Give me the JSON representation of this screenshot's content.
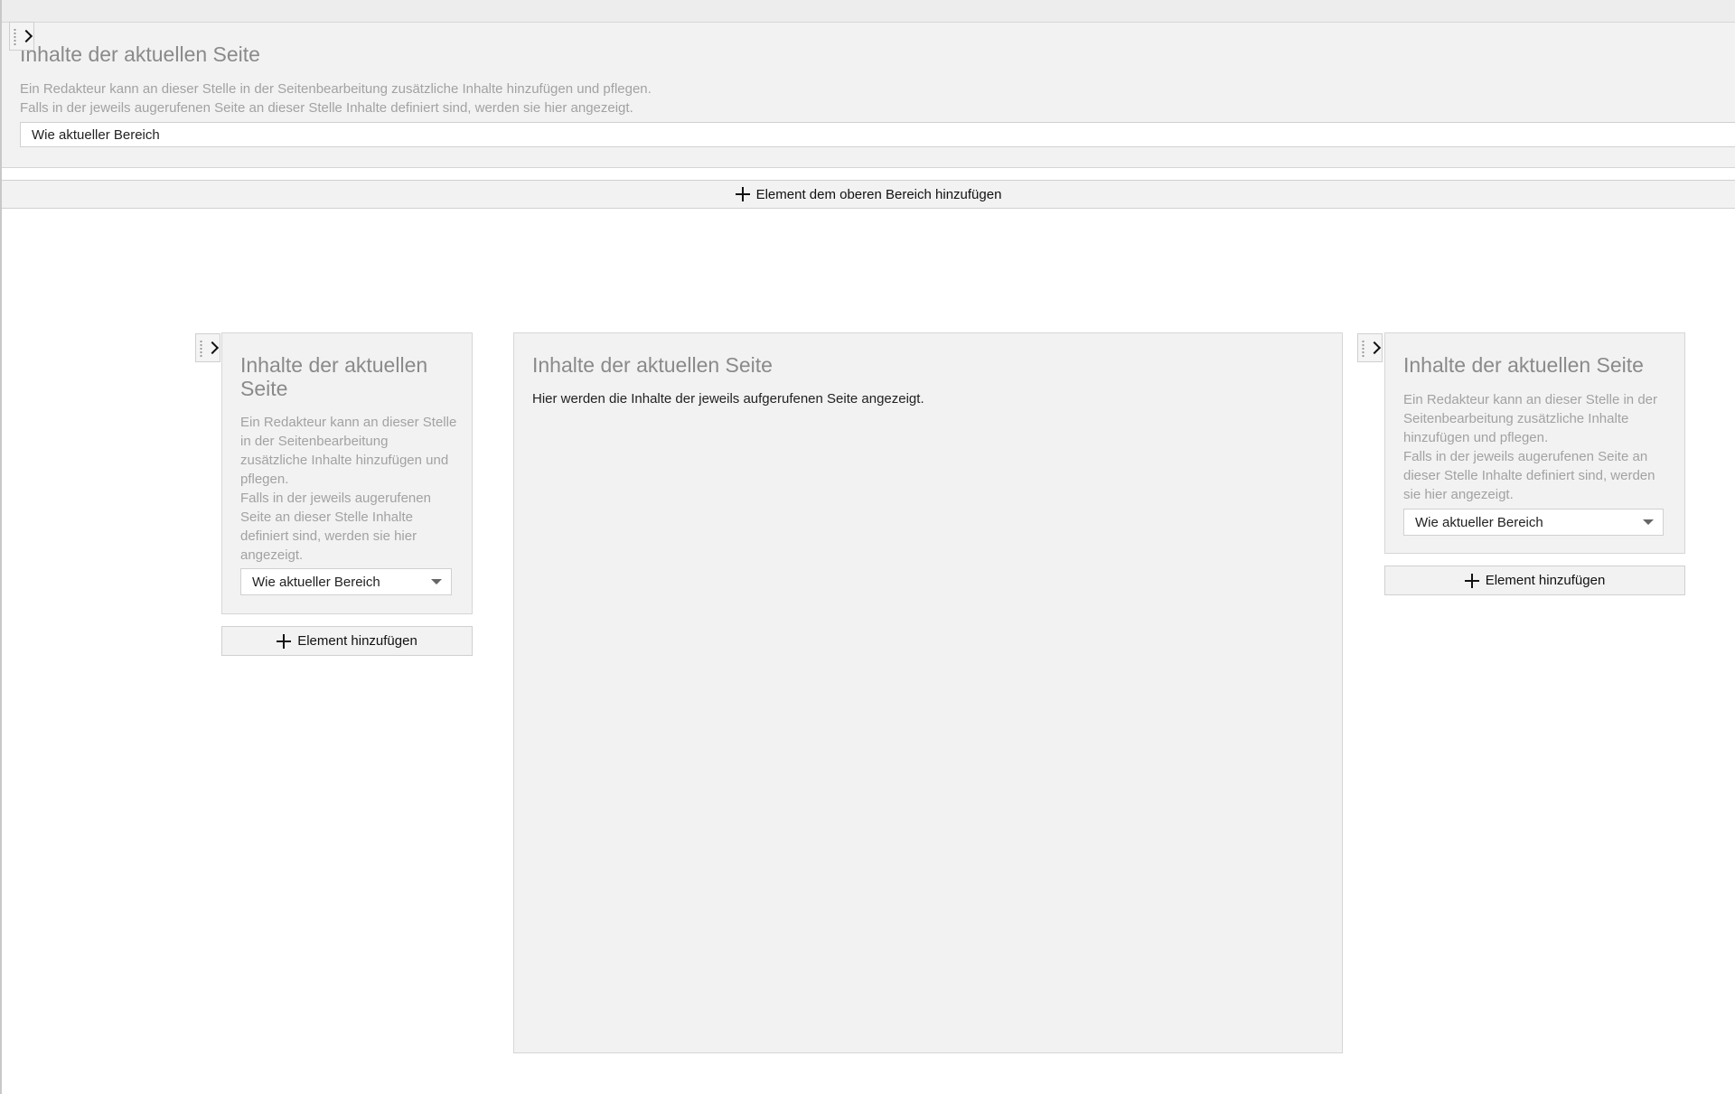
{
  "top_area": {
    "title": "Inhalte der aktuellen Seite",
    "desc_lines": [
      "Ein Redakteur kann an dieser Stelle in der Seitenbearbeitung zusätzliche Inhalte hinzufügen und pflegen.",
      "Falls in der jeweils augerufenen Seite an dieser Stelle Inhalte definiert sind, werden sie hier angezeigt."
    ],
    "select_value": "Wie aktueller Bereich",
    "add_button_label": "Element dem oberen Bereich hinzufügen"
  },
  "left_area": {
    "title": "Inhalte der aktuellen Seite",
    "desc_lines": [
      "Ein Redakteur kann an dieser Stelle in der Seitenbearbeitung zusätzliche Inhalte hinzufügen und pflegen.",
      "Falls in der jeweils augerufenen Seite an dieser Stelle Inhalte definiert sind, werden sie hier angezeigt."
    ],
    "select_value": "Wie aktueller Bereich",
    "add_button_label": "Element hinzufügen"
  },
  "center_area": {
    "title": "Inhalte der aktuellen Seite",
    "text": "Hier werden die Inhalte der jeweils aufgerufenen Seite angezeigt."
  },
  "right_area": {
    "title": "Inhalte der aktuellen Seite",
    "desc_lines": [
      "Ein Redakteur kann an dieser Stelle in der Seitenbearbeitung zusätzliche Inhalte hinzufügen und pflegen.",
      "Falls in der jeweils augerufenen Seite an dieser Stelle Inhalte definiert sind, werden sie hier angezeigt."
    ],
    "select_value": "Wie aktueller Bereich",
    "add_button_label": "Element hinzufügen"
  }
}
